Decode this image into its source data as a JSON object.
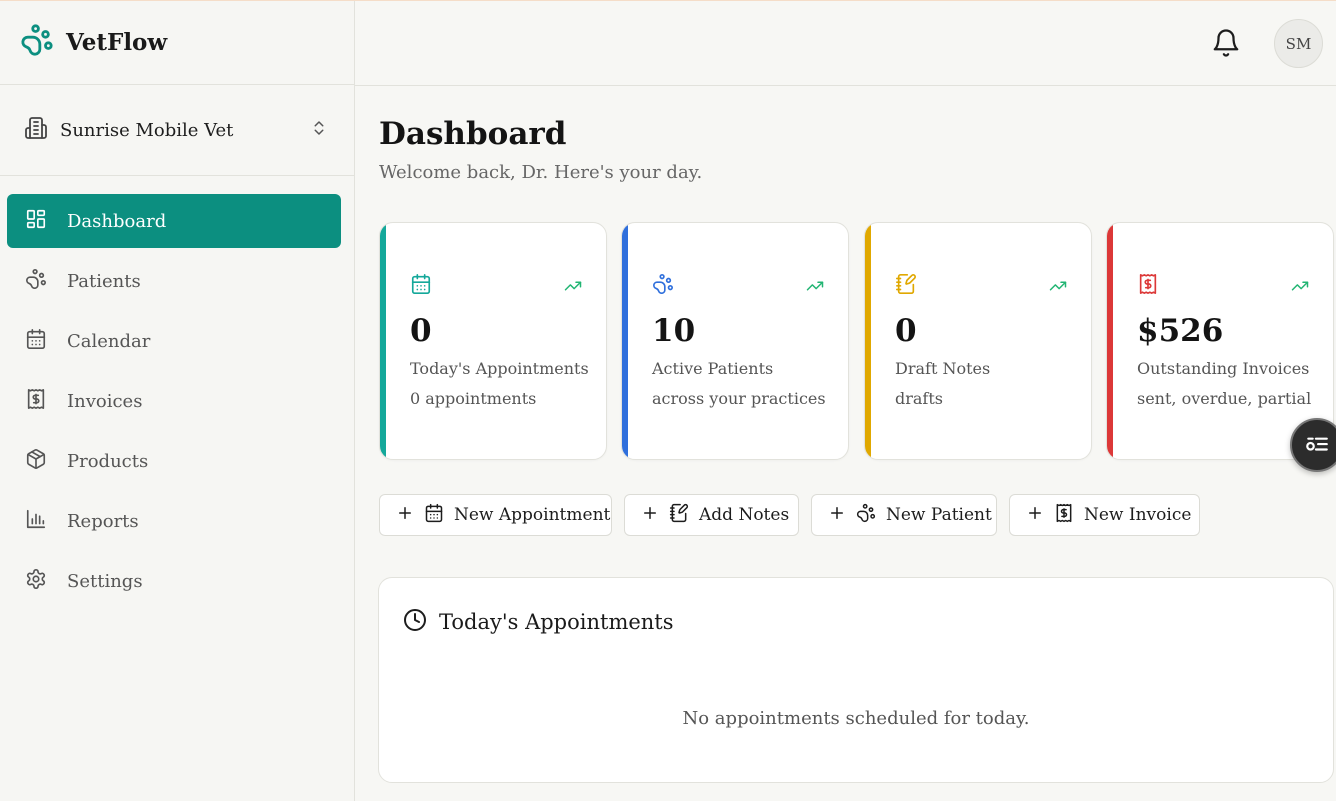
{
  "brand": {
    "name": "VetFlow",
    "accent": "#0c8f80"
  },
  "practice": {
    "name": "Sunrise Mobile Vet"
  },
  "nav": [
    {
      "label": "Dashboard",
      "icon": "dashboard-icon",
      "active": true
    },
    {
      "label": "Patients",
      "icon": "paw-icon"
    },
    {
      "label": "Calendar",
      "icon": "calendar-icon"
    },
    {
      "label": "Invoices",
      "icon": "receipt-icon"
    },
    {
      "label": "Products",
      "icon": "box-icon"
    },
    {
      "label": "Reports",
      "icon": "bar-chart-icon"
    },
    {
      "label": "Settings",
      "icon": "gear-icon"
    }
  ],
  "header": {
    "avatar_initials": "SM"
  },
  "page": {
    "title": "Dashboard",
    "subtitle": "Welcome back, Dr. Here's your day."
  },
  "stats": [
    {
      "value": "0",
      "label": "Today's Appointments",
      "sub": "0 appointments",
      "color": "#14a89a",
      "icon": "calendar-icon"
    },
    {
      "value": "10",
      "label": "Active Patients",
      "sub": "across your practices",
      "color": "#2f6fdc",
      "icon": "paw-icon"
    },
    {
      "value": "0",
      "label": "Draft Notes",
      "sub": "drafts",
      "color": "#e0a800",
      "icon": "notes-icon"
    },
    {
      "value": "$526",
      "label": "Outstanding Invoices",
      "sub": "sent, overdue, partial",
      "color": "#dc3838",
      "icon": "receipt-icon"
    }
  ],
  "quick_actions": [
    {
      "label": "New Appointment",
      "icon": "calendar-icon"
    },
    {
      "label": "Add Notes",
      "icon": "notes-icon"
    },
    {
      "label": "New Patient",
      "icon": "paw-icon"
    },
    {
      "label": "New Invoice",
      "icon": "receipt-icon"
    }
  ],
  "appointments": {
    "title": "Today's Appointments",
    "empty_text": "No appointments scheduled for today."
  },
  "colors": {
    "trend": "#22b573"
  }
}
